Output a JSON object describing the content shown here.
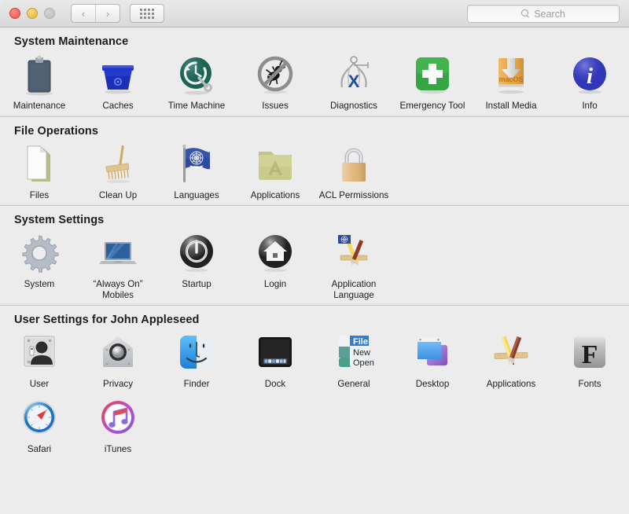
{
  "titlebar": {
    "traffic_lights": [
      "close",
      "minimize",
      "zoom"
    ],
    "nav": {
      "back": "‹",
      "forward": "›"
    },
    "grid_button": "grid-view",
    "search": {
      "placeholder": "Search",
      "value": ""
    }
  },
  "sections": [
    {
      "title": "System Maintenance",
      "items": [
        {
          "label": "Maintenance",
          "icon": "clipboard-icon"
        },
        {
          "label": "Caches",
          "icon": "blue-bin-icon"
        },
        {
          "label": "Time Machine",
          "icon": "time-machine-icon"
        },
        {
          "label": "Issues",
          "icon": "no-bug-icon"
        },
        {
          "label": "Diagnostics",
          "icon": "caliper-x-icon"
        },
        {
          "label": "Emergency Tool",
          "icon": "green-cross-icon"
        },
        {
          "label": "Install Media",
          "icon": "install-media-icon"
        },
        {
          "label": "Info",
          "icon": "info-circle-icon"
        }
      ]
    },
    {
      "title": "File Operations",
      "items": [
        {
          "label": "Files",
          "icon": "document-icon"
        },
        {
          "label": "Clean Up",
          "icon": "broom-icon"
        },
        {
          "label": "Languages",
          "icon": "un-flag-icon"
        },
        {
          "label": "Applications",
          "icon": "applications-folder-icon"
        },
        {
          "label": "ACL Permissions",
          "icon": "padlock-icon"
        }
      ]
    },
    {
      "title": "System Settings",
      "items": [
        {
          "label": "System",
          "icon": "gear-icon"
        },
        {
          "label": "“Always On” Mobiles",
          "icon": "laptop-icon"
        },
        {
          "label": "Startup",
          "icon": "power-button-icon"
        },
        {
          "label": "Login",
          "icon": "house-icon"
        },
        {
          "label": "Application Language",
          "icon": "app-language-icon"
        }
      ]
    },
    {
      "title": "User Settings for John Appleseed",
      "items": [
        {
          "label": "User",
          "icon": "user-silhouette-icon"
        },
        {
          "label": "Privacy",
          "icon": "privacy-security-icon"
        },
        {
          "label": "Finder",
          "icon": "finder-face-icon"
        },
        {
          "label": "Dock",
          "icon": "dock-icon"
        },
        {
          "label": "General",
          "icon": "general-menu-icon"
        },
        {
          "label": "Desktop",
          "icon": "desktop-windows-icon"
        },
        {
          "label": "Applications",
          "icon": "app-store-tools-icon"
        },
        {
          "label": "Fonts",
          "icon": "fonts-f-icon"
        },
        {
          "label": "Safari",
          "icon": "safari-compass-icon"
        },
        {
          "label": "iTunes",
          "icon": "itunes-note-icon"
        }
      ]
    }
  ],
  "colors": {
    "window_bg": "#ececec",
    "titlebar_top": "#e9e9e9",
    "titlebar_bottom": "#d9d9d9",
    "divider": "#c9c9c9",
    "text": "#1d1d1d",
    "traffic_red": "#e8554a",
    "traffic_yellow": "#e8b33c",
    "traffic_gray": "#bcbcbc",
    "green_cross": "#35a742",
    "info_blue": "#3b3fd8",
    "caches_blue": "#1b2fb8",
    "time_machine_green": "#1d6b5a",
    "install_media_orange": "#e8a33c"
  }
}
